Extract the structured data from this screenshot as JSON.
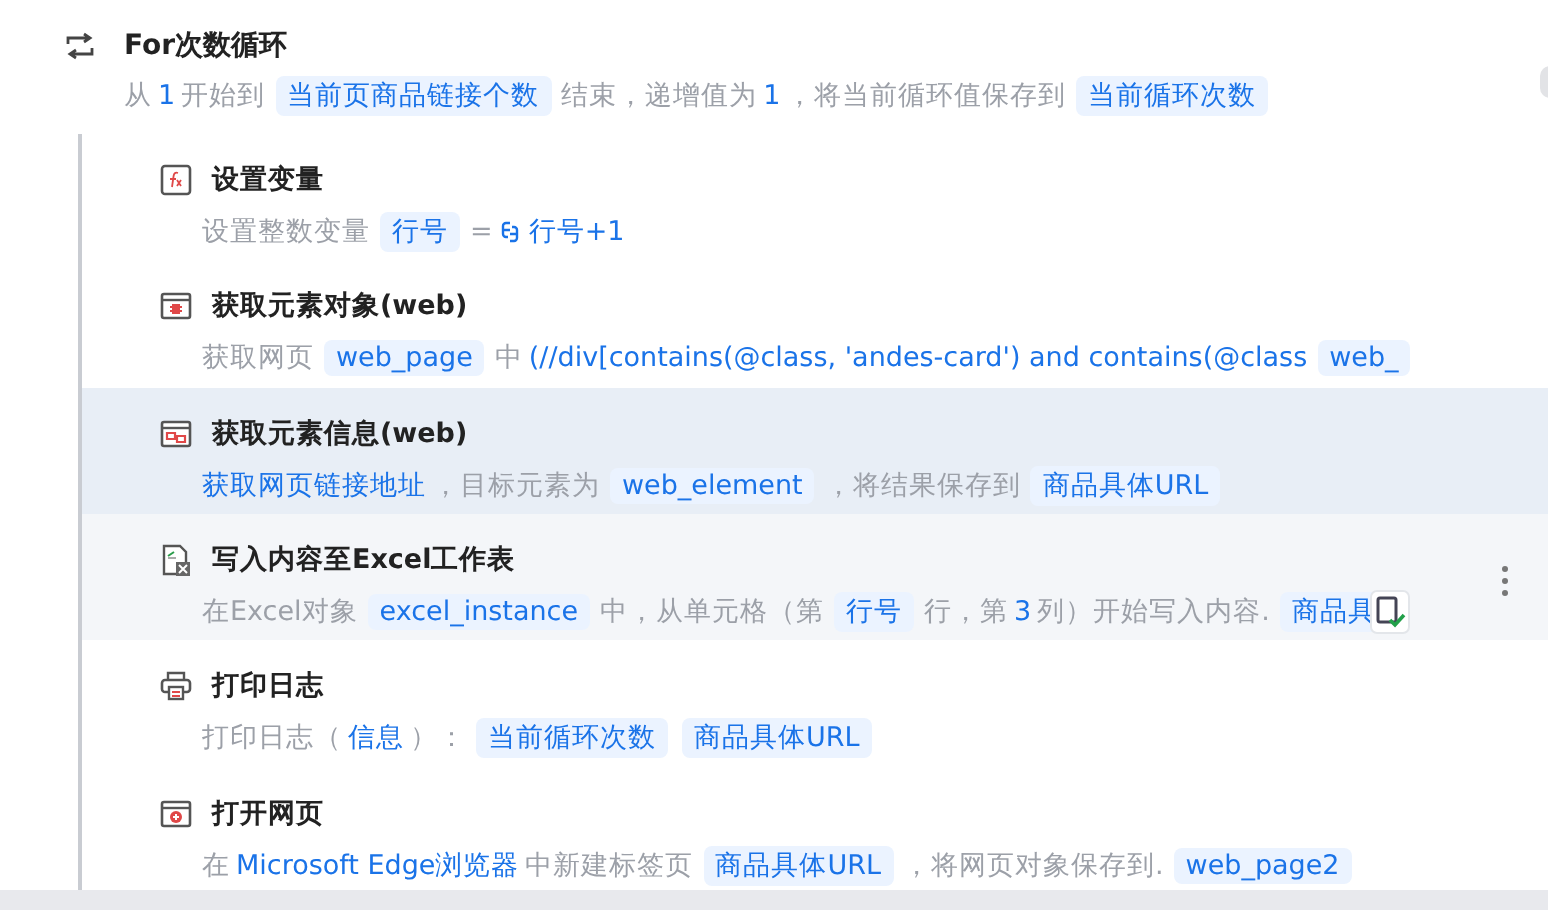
{
  "loop": {
    "title": "For次数循环",
    "description": [
      {
        "kind": "text",
        "text": "从"
      },
      {
        "kind": "value",
        "text": "1"
      },
      {
        "kind": "text",
        "text": "开始到"
      },
      {
        "kind": "var",
        "text": "当前页商品链接个数"
      },
      {
        "kind": "text",
        "text": "结束，递增值为"
      },
      {
        "kind": "value",
        "text": "1"
      },
      {
        "kind": "text",
        "text": "，将当前循环值保存到"
      },
      {
        "kind": "var",
        "text": "当前循环次数"
      }
    ]
  },
  "steps": [
    {
      "kind": "function",
      "title": "设置变量",
      "selected": false,
      "hovered": false,
      "description": [
        {
          "kind": "text",
          "text": "设置整数变量"
        },
        {
          "kind": "var",
          "text": "行号"
        },
        {
          "kind": "text",
          "text": "="
        },
        {
          "kind": "expr",
          "text": "行号+1"
        }
      ]
    },
    {
      "kind": "web-element",
      "title": "获取元素对象(web)",
      "selected": false,
      "hovered": false,
      "description": [
        {
          "kind": "text",
          "text": "获取网页"
        },
        {
          "kind": "var",
          "text": "web_page"
        },
        {
          "kind": "text",
          "text": "中"
        },
        {
          "kind": "value",
          "text": "(//div[contains(@class, 'andes-card') and contains(@class"
        },
        {
          "kind": "var",
          "text": "web_"
        }
      ]
    },
    {
      "kind": "web-info",
      "title": "获取元素信息(web)",
      "selected": true,
      "hovered": false,
      "description": [
        {
          "kind": "value",
          "text": "获取网页链接地址"
        },
        {
          "kind": "text",
          "text": "，目标元素为"
        },
        {
          "kind": "var",
          "text": "web_element"
        },
        {
          "kind": "text",
          "text": "，将结果保存到"
        },
        {
          "kind": "var",
          "text": "商品具体URL"
        }
      ]
    },
    {
      "kind": "excel",
      "title": "写入内容至Excel工作表",
      "selected": false,
      "hovered": true,
      "description": [
        {
          "kind": "text",
          "text": "在Excel对象"
        },
        {
          "kind": "var",
          "text": "excel_instance"
        },
        {
          "kind": "text",
          "text": "中，从单元格（第"
        },
        {
          "kind": "var",
          "text": "行号"
        },
        {
          "kind": "text",
          "text": "行，第"
        },
        {
          "kind": "value",
          "text": "3"
        },
        {
          "kind": "text",
          "text": "列）开始写入内容."
        },
        {
          "kind": "var",
          "text": "商品具"
        }
      ]
    },
    {
      "kind": "printer",
      "title": "打印日志",
      "selected": false,
      "hovered": false,
      "description": [
        {
          "kind": "text",
          "text": "打印日志（"
        },
        {
          "kind": "value",
          "text": "信息"
        },
        {
          "kind": "text",
          "text": "）："
        },
        {
          "kind": "var",
          "text": "当前循环次数"
        },
        {
          "kind": "var",
          "text": "商品具体URL"
        }
      ]
    },
    {
      "kind": "browser",
      "title": "打开网页",
      "selected": false,
      "hovered": false,
      "description": [
        {
          "kind": "text",
          "text": "在"
        },
        {
          "kind": "value",
          "text": "Microsoft Edge浏览器"
        },
        {
          "kind": "text",
          "text": "中新建标签页"
        },
        {
          "kind": "var",
          "text": "商品具体URL"
        },
        {
          "kind": "text",
          "text": "，将网页对象保存到."
        },
        {
          "kind": "var",
          "text": "web_page2"
        }
      ]
    }
  ]
}
